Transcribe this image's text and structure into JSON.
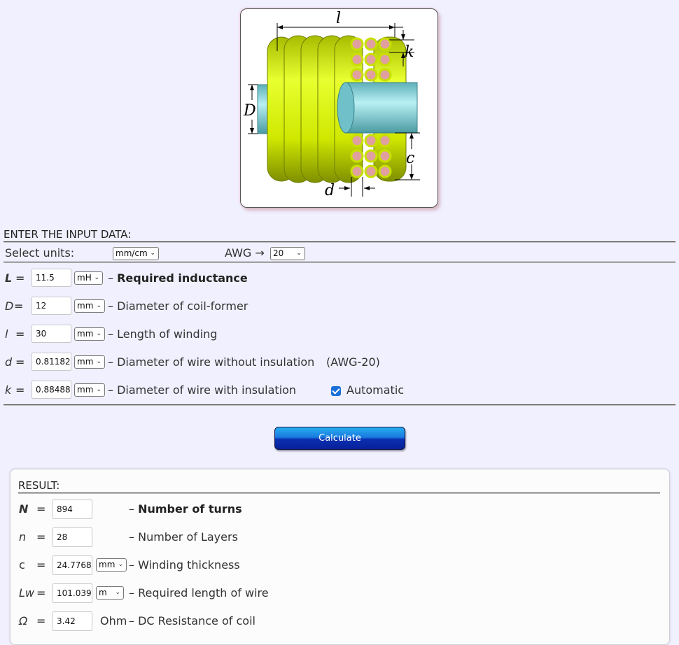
{
  "figure": {
    "labels": {
      "l": "l",
      "k": "k",
      "D": "D",
      "c": "c",
      "d": "d"
    }
  },
  "input": {
    "title": "ENTER THE INPUT DATA:",
    "select_units_label": "Select units:",
    "units_value": "mm/cm",
    "awg_label": "AWG →",
    "awg_value": "20",
    "rows": [
      {
        "symbol": "L",
        "eq": "=",
        "value": "11.5",
        "unit": "mH",
        "desc": "Required inductance",
        "dash": "–"
      },
      {
        "symbol": "D",
        "eq": "=",
        "value": "12",
        "unit": "mm",
        "desc": "Diameter of coil-former",
        "dash": "–"
      },
      {
        "symbol": "l",
        "eq": "=",
        "value": "30",
        "unit": "mm",
        "desc": "Length of winding",
        "dash": "–"
      },
      {
        "symbol": "d",
        "eq": "=",
        "value": "0.81182",
        "unit": "mm",
        "desc": "Diameter of wire without insulation",
        "extra": "(AWG-20)",
        "dash": "–"
      },
      {
        "symbol": "k",
        "eq": "=",
        "value": "0.88488",
        "unit": "mm",
        "desc": "Diameter of wire with insulation",
        "dash": "–"
      }
    ],
    "automatic_label": "Automatic",
    "automatic_checked": true
  },
  "calculate_label": "Calculate",
  "result": {
    "title": "RESULT:",
    "rows": [
      {
        "symbol": "N",
        "eq": "=",
        "value": "894",
        "desc": "Number of turns",
        "dash": "–"
      },
      {
        "symbol": "n",
        "eq": "=",
        "value": "28",
        "desc": "Number of Layers",
        "dash": "–"
      },
      {
        "symbol": "c",
        "eq": "=",
        "value": "24.7768",
        "unit": "mm",
        "desc": "Winding thickness",
        "dash": "–"
      },
      {
        "symbol": "Lw",
        "eq": "=",
        "value": "101.039",
        "unit": "m",
        "desc": "Required length of wire",
        "dash": "–"
      },
      {
        "symbol": "Ω",
        "eq": "=",
        "value": "3.42",
        "unit_text": "Ohm",
        "desc": "DC Resistance of coil",
        "dash": "–"
      }
    ]
  },
  "colors": {
    "page_bg": "#f0f0ff",
    "coil": "#c8e000",
    "former": "#7fd0d8",
    "wire_core": "#e0a0a0",
    "checkbox": "#1a6fd8"
  }
}
